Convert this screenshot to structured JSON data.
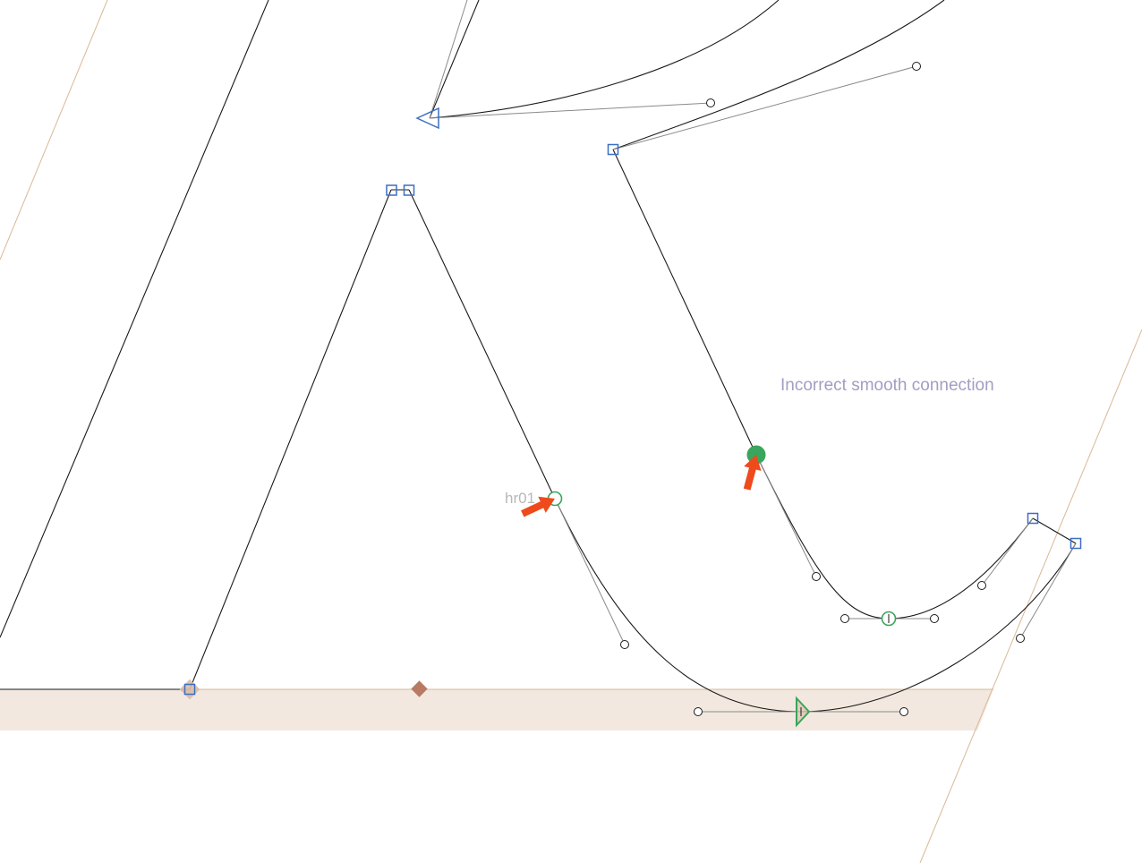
{
  "editor": {
    "warning_label": "Incorrect smooth connection",
    "node_name": "hr01"
  },
  "colors": {
    "outline": "#1a1a1a",
    "handle_line": "#8a8a8a",
    "corner_node": "#3b6fc4",
    "smooth_node": "#3aa55c",
    "baseline_zone": "#f2e8df",
    "metric_line": "#d9b896",
    "anchor_marker": "#b87a63",
    "warning_arrow": "#ee4a1c",
    "warning_text": "#a59cc3",
    "node_name_text": "#b8b8b8"
  },
  "icons": {
    "corner_node": "square-node-icon",
    "smooth_node": "circle-node-icon",
    "start_node": "triangle-start-node-icon",
    "handle": "handle-point-icon",
    "anchor": "diamond-anchor-icon",
    "warning": "warning-arrow-icon"
  }
}
